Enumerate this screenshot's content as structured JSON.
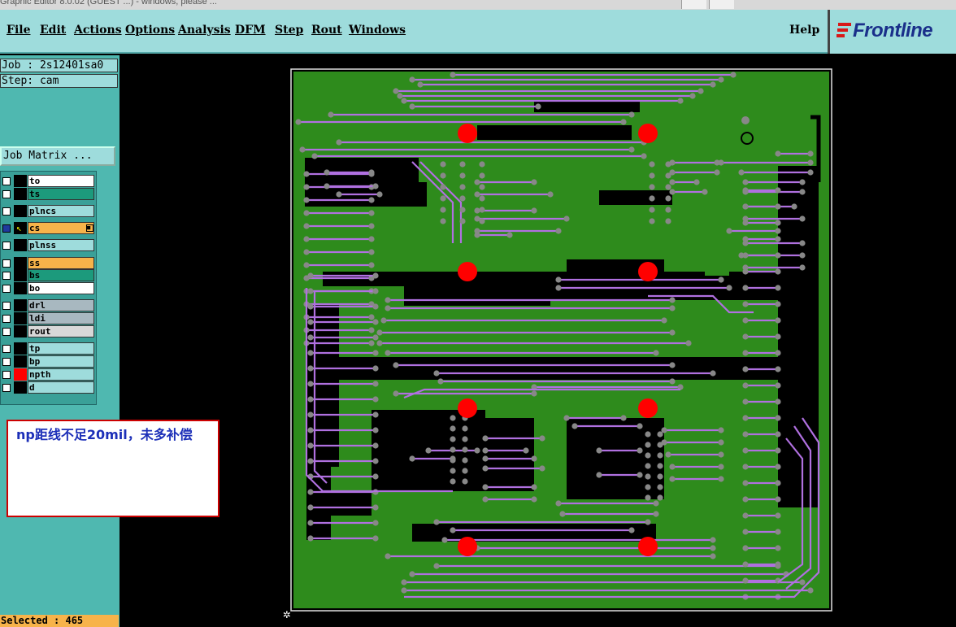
{
  "window": {
    "title": "Graphic Editor 8.0.02 (GUEST ...) - windows, please ..."
  },
  "menu": {
    "items": [
      {
        "key": "file",
        "label": "File"
      },
      {
        "key": "edit",
        "label": "Edit"
      },
      {
        "key": "actions",
        "label": "Actions"
      },
      {
        "key": "options",
        "label": "Options"
      },
      {
        "key": "analysis",
        "label": "Analysis"
      },
      {
        "key": "dfm",
        "label": "DFM"
      },
      {
        "key": "step",
        "label": "Step"
      },
      {
        "key": "rout",
        "label": "Rout"
      },
      {
        "key": "windows",
        "label": "Windows"
      }
    ],
    "help": "Help"
  },
  "logo": {
    "text": "Frontline"
  },
  "job": {
    "label": "Job : 2s12401sa0",
    "step": "Step: cam",
    "matrix_button": "Job Matrix ..."
  },
  "layers": [
    {
      "name": "to",
      "color": "#ffffff",
      "checked": false
    },
    {
      "name": "ts",
      "color": "#1c9a7c",
      "checked": false
    },
    {
      "name": "plncs",
      "color": "#9edcdc",
      "checked": false
    },
    {
      "name": "cs",
      "color": "#f7b34a",
      "checked": true,
      "active": true
    },
    {
      "name": "plnss",
      "color": "#9edcdc",
      "checked": false
    },
    {
      "name": "ss",
      "color": "#f7b34a",
      "checked": false
    },
    {
      "name": "bs",
      "color": "#1c9a7c",
      "checked": false
    },
    {
      "name": "bo",
      "color": "#ffffff",
      "checked": false
    },
    {
      "name": "drl",
      "color": "#a8b8c0",
      "checked": false
    },
    {
      "name": "ldi",
      "color": "#a8b8c0",
      "checked": false
    },
    {
      "name": "rout",
      "color": "#d8d8d8",
      "checked": false
    },
    {
      "name": "tp",
      "color": "#9edcdc",
      "checked": false
    },
    {
      "name": "bp",
      "color": "#9edcdc",
      "checked": false
    },
    {
      "name": "npth",
      "color": "#9edcdc",
      "checked": false,
      "swatch": "#ff0000"
    },
    {
      "name": "d",
      "color": "#9edcdc",
      "checked": false
    }
  ],
  "status": {
    "selected": "Selected : 465"
  },
  "note": {
    "text": "np距线不足20mil，未多补偿"
  },
  "colors": {
    "board": "#2e8b1c",
    "trace": "#b070e0",
    "pad": "#888888",
    "npth": "#ff0000",
    "panel": "#9edcdc"
  }
}
